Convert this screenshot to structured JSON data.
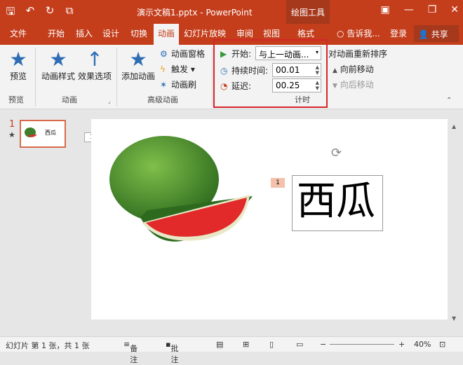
{
  "titlebar": {
    "title": "演示文稿1.pptx - PowerPoint",
    "contextual_tab_group": "绘图工具",
    "qat": {
      "save": "🖫",
      "undo": "↶",
      "redo": "↻",
      "present": "⧉"
    },
    "window_buttons": {
      "ribbon_display": "▣",
      "minimize": "—",
      "restore": "❐",
      "close": "✕"
    }
  },
  "tabs": [
    "文件",
    "开始",
    "插入",
    "设计",
    "切换",
    "动画",
    "幻灯片放映",
    "审阅",
    "视图",
    "格式"
  ],
  "active_tab": "动画",
  "right_tabs": {
    "tell_me": "告诉我...",
    "login": "登录",
    "share": "共享"
  },
  "ribbon": {
    "preview": {
      "button": "预览",
      "group": "预览"
    },
    "animation": {
      "styles": "动画样式",
      "effects": "效果选项",
      "group": "动画"
    },
    "advanced": {
      "add": "添加动画",
      "pane": "动画窗格",
      "trigger": "触发",
      "painter": "动画刷",
      "group": "高级动画"
    },
    "timing": {
      "start_label": "开始:",
      "start_value": "与上一动画...",
      "duration_label": "持续时间:",
      "duration_value": "00.01",
      "delay_label": "延迟:",
      "delay_value": "00.25",
      "group": "计时"
    },
    "reorder": {
      "title": "对动画重新排序",
      "forward": "向前移动",
      "backward": "向后移动"
    }
  },
  "thumbnail": {
    "number": "1",
    "star": "★",
    "text": "西瓜"
  },
  "slide": {
    "anim_tag_left": "1",
    "anim_tag_text": "1",
    "textbox": "西瓜"
  },
  "status": {
    "slide_info": "幻灯片 第 1 张，共 1 张",
    "notes": "备注",
    "comments": "批注",
    "zoom": "40%"
  },
  "colors": {
    "accent": "#c43e1c",
    "highlight": "#d6252b",
    "icon_blue": "#2e6db4"
  }
}
